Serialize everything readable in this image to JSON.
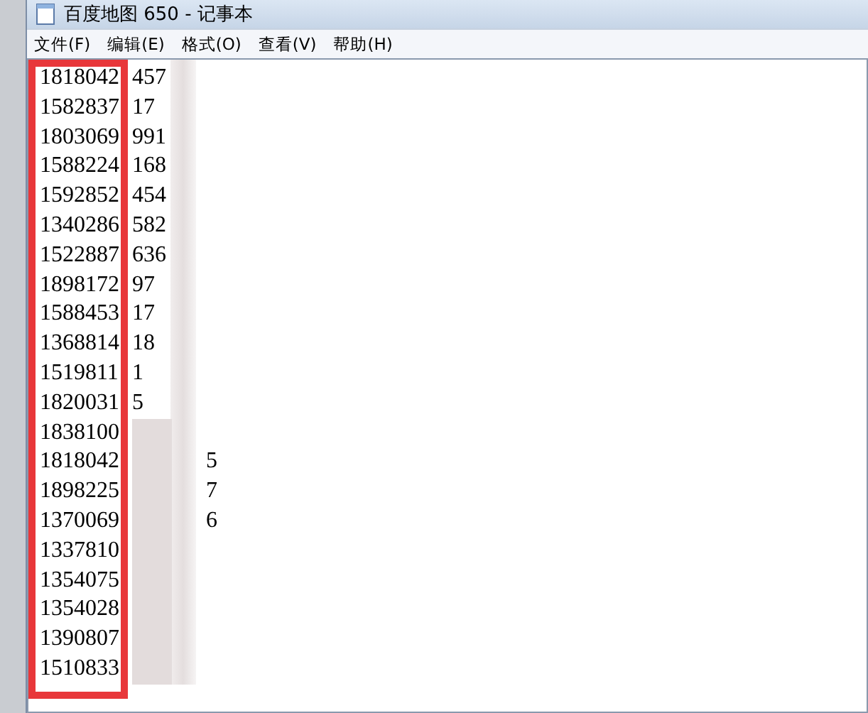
{
  "window": {
    "title": "百度地图 650 - 记事本"
  },
  "menu": [
    "文件(F)",
    "编辑(E)",
    "格式(O)",
    "查看(V)",
    "帮助(H)"
  ],
  "lines": [
    {
      "text": "1818042",
      "tail": "457",
      "masked": false
    },
    {
      "text": "1582837",
      "tail": "17",
      "masked": false
    },
    {
      "text": "1803069",
      "tail": "991",
      "masked": false
    },
    {
      "text": "1588224",
      "tail": "168",
      "masked": false
    },
    {
      "text": "1592852",
      "tail": "454",
      "masked": false
    },
    {
      "text": "1340286",
      "tail": "582",
      "masked": false
    },
    {
      "text": "1522887",
      "tail": "636",
      "masked": false
    },
    {
      "text": "1898172",
      "tail": "97",
      "masked": false
    },
    {
      "text": "1588453",
      "tail": "17",
      "masked": false
    },
    {
      "text": "1368814",
      "tail": "18",
      "masked": false
    },
    {
      "text": "1519811",
      "tail": "1",
      "masked": false
    },
    {
      "text": "1820031",
      "tail": "5",
      "masked": false
    },
    {
      "text": "1838100",
      "masked": true
    },
    {
      "text": "1818042",
      "tail": "5",
      "masked": true
    },
    {
      "text": "1898225",
      "tail": "7",
      "masked": true
    },
    {
      "text": "1370069",
      "tail": "6",
      "masked": true
    },
    {
      "text": "1337810",
      "masked": true
    },
    {
      "text": "1354075",
      "masked": true
    },
    {
      "text": "1354028",
      "masked": true
    },
    {
      "text": "1390807",
      "masked": true
    },
    {
      "text": "1510833",
      "masked": true
    }
  ]
}
